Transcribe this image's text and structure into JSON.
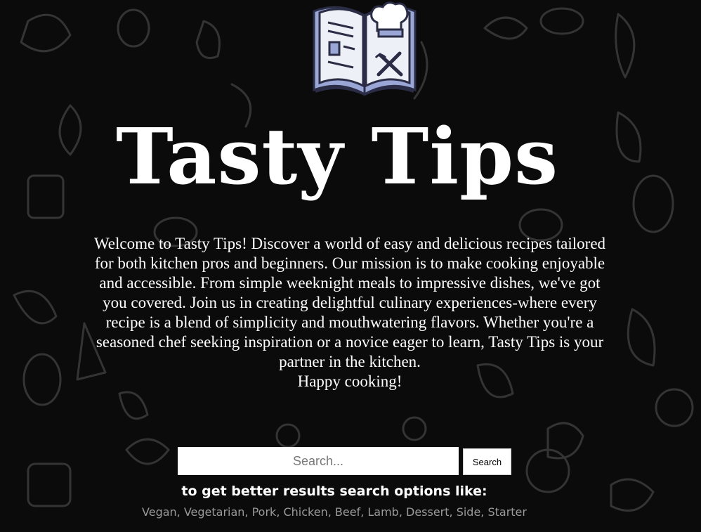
{
  "logo": {
    "icon": "recipe-book-chef-hat-icon",
    "colors": {
      "pages": "#eef0f8",
      "cover": "#9aa6d6",
      "outline": "#2a2d45",
      "hat": "#ffffff"
    }
  },
  "title": "Tasty Tips",
  "intro": {
    "paragraph": "Welcome to Tasty Tips! Discover a world of easy and delicious recipes tailored for both kitchen pros and beginners. Our mission is to make cooking enjoyable and accessible. From simple weeknight meals to impressive dishes, we've got you covered. Join us in creating delightful culinary experiences-where every recipe is a blend of simplicity and mouthwatering flavors. Whether you're a seasoned chef seeking inspiration or a novice eager to learn, Tasty Tips is your partner in the kitchen.",
    "signoff": "Happy cooking!"
  },
  "search": {
    "value": "",
    "placeholder": "Search...",
    "button_label": "Search"
  },
  "hint": {
    "text": "to get better results search options like:",
    "options": "Vegan, Vegetarian, Pork, Chicken, Beef, Lamb, Dessert, Side, Starter"
  },
  "theme": {
    "background": "#0b0b0b",
    "doodle_color": "#3a3a3a",
    "text": "#ffffff",
    "muted_text": "#9a9a9a"
  }
}
